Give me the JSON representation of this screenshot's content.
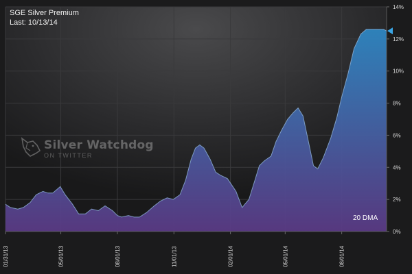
{
  "header": {
    "title": "SGE Silver Premium",
    "last": "Last: 10/13/14"
  },
  "watermark": {
    "name": "Silver Watchdog",
    "sub": "ON TWITTER",
    "icon": "dog-head-icon"
  },
  "chart_data": {
    "type": "area",
    "title": "SGE Silver Premium",
    "subtitle": "Last: 10/13/14",
    "series": [
      {
        "name": "20 DMA",
        "x": [
          "2013-01-31",
          "2013-02-08",
          "2013-02-20",
          "2013-03-01",
          "2013-03-12",
          "2013-03-22",
          "2013-04-02",
          "2013-04-10",
          "2013-04-18",
          "2013-04-30",
          "2013-05-08",
          "2013-05-20",
          "2013-05-30",
          "2013-06-10",
          "2013-06-20",
          "2013-07-01",
          "2013-07-12",
          "2013-07-24",
          "2013-08-01",
          "2013-08-08",
          "2013-08-19",
          "2013-08-28",
          "2013-09-06",
          "2013-09-18",
          "2013-09-30",
          "2013-10-10",
          "2013-10-21",
          "2013-10-31",
          "2013-11-11",
          "2013-11-20",
          "2013-11-29",
          "2013-12-06",
          "2013-12-13",
          "2013-12-20",
          "2013-12-30",
          "2014-01-08",
          "2014-01-16",
          "2014-01-27",
          "2014-02-10",
          "2014-02-20",
          "2014-03-03",
          "2014-03-12",
          "2014-03-20",
          "2014-03-28",
          "2014-04-08",
          "2014-04-16",
          "2014-04-25",
          "2014-05-05",
          "2014-05-14",
          "2014-05-22",
          "2014-05-30",
          "2014-06-09",
          "2014-06-16",
          "2014-06-23",
          "2014-07-02",
          "2014-07-14",
          "2014-07-24",
          "2014-08-01",
          "2014-08-11",
          "2014-08-21",
          "2014-09-01",
          "2014-09-10",
          "2014-09-19",
          "2014-09-29",
          "2014-10-08",
          "2014-10-13"
        ],
        "values": [
          1.7,
          1.5,
          1.4,
          1.5,
          1.8,
          2.3,
          2.5,
          2.4,
          2.4,
          2.8,
          2.3,
          1.7,
          1.1,
          1.1,
          1.4,
          1.3,
          1.6,
          1.3,
          1.0,
          0.9,
          1.0,
          0.9,
          0.9,
          1.2,
          1.6,
          1.9,
          2.1,
          2.0,
          2.3,
          3.2,
          4.5,
          5.2,
          5.4,
          5.2,
          4.5,
          3.7,
          3.5,
          3.3,
          2.5,
          1.5,
          2.0,
          3.1,
          4.1,
          4.4,
          4.7,
          5.6,
          6.3,
          7.0,
          7.4,
          7.7,
          7.2,
          5.4,
          4.1,
          3.9,
          4.6,
          5.8,
          7.1,
          8.4,
          9.8,
          11.4,
          12.3,
          12.6,
          12.6,
          12.6,
          12.6,
          12.5
        ]
      }
    ],
    "x_ticks": [
      "01/31/13",
      "05/01/13",
      "08/01/13",
      "11/01/13",
      "02/01/14",
      "05/01/14",
      "08/01/14"
    ],
    "x_tick_dates": [
      "2013-01-31",
      "2013-05-01",
      "2013-08-01",
      "2013-11-01",
      "2014-02-01",
      "2014-05-01",
      "2014-08-01"
    ],
    "x_range": [
      "2013-01-31",
      "2014-10-13"
    ],
    "y_ticks": [
      "0%",
      "2%",
      "4%",
      "6%",
      "8%",
      "10%",
      "12%",
      "14%"
    ],
    "y_tick_values": [
      0,
      2,
      4,
      6,
      8,
      10,
      12,
      14
    ],
    "ylim": [
      0,
      14
    ],
    "y_axis_side": "right",
    "series_label": "20 DMA",
    "grid": true,
    "colors": {
      "background": "#1b1b1c",
      "area_top": "#2e86c1",
      "area_bottom": "#5a3a84",
      "marker": "#3aa6e6",
      "grid": "#3a3a3c",
      "tick_text": "#d8d8d8"
    }
  }
}
